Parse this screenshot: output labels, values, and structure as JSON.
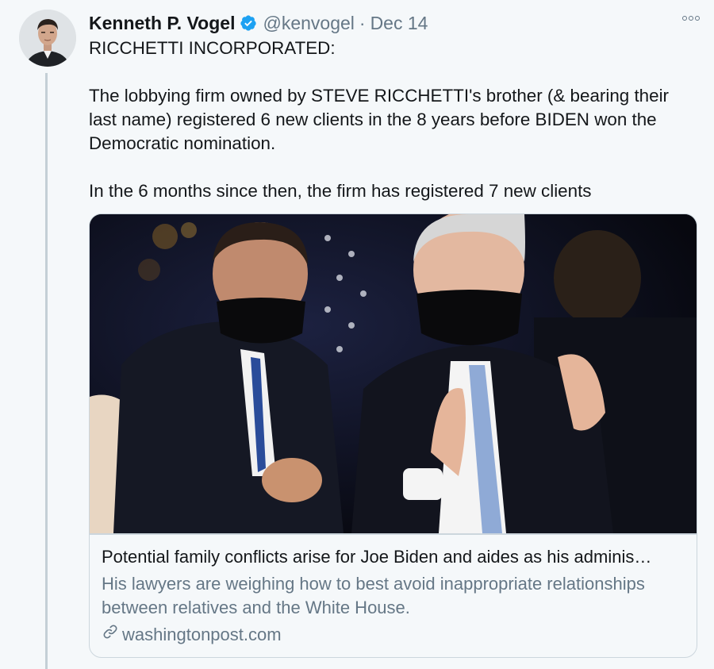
{
  "author": {
    "display_name": "Kenneth P. Vogel",
    "handle": "@kenvogel",
    "separator": "·",
    "date": "Dec 14",
    "verified": true
  },
  "tweet": {
    "line1": "RICCHETTI INCORPORATED:",
    "paragraph2": "The lobbying firm owned by STEVE RICCHETTI's brother (& bearing their last name) registered 6 new clients in the 8 years before BIDEN won the Democratic nomination.",
    "paragraph3": "In the 6 months since then, the firm has registered 7 new clients"
  },
  "card": {
    "title": "Potential family conflicts arise for Joe Biden and aides as his adminis…",
    "description": "His lawyers are weighing how to best avoid inappropriate relationships between relatives and the White House.",
    "domain": "washingtonpost.com"
  },
  "colors": {
    "text": "#14171a",
    "secondary": "#657786",
    "verified": "#1da1f2",
    "border": "#ccd6dd",
    "background": "#f5f8fa"
  },
  "icons": {
    "verified": "verified-badge-icon",
    "more": "more-options-icon",
    "link": "link-icon"
  }
}
